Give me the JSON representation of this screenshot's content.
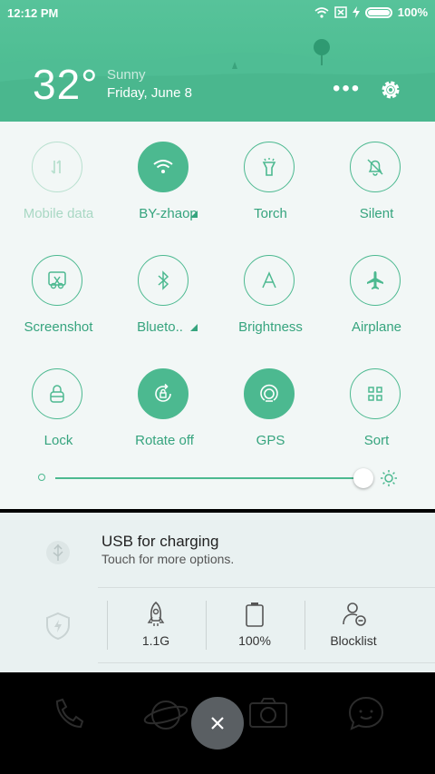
{
  "status": {
    "time": "12:12 PM",
    "battery": "100%"
  },
  "weather": {
    "temperature": "32°",
    "condition": "Sunny",
    "date": "Friday, June 8",
    "more": "•••"
  },
  "tiles": [
    {
      "label": "Mobile data",
      "icon": "mobile-data-icon",
      "state": "dim"
    },
    {
      "label": "BY-zhaop",
      "icon": "wifi-icon",
      "state": "active"
    },
    {
      "label": "Torch",
      "icon": "torch-icon",
      "state": "normal"
    },
    {
      "label": "Silent",
      "icon": "bell-off-icon",
      "state": "normal"
    },
    {
      "label": "Screenshot",
      "icon": "scissors-icon",
      "state": "normal"
    },
    {
      "label": "Blueto..",
      "icon": "bluetooth-icon",
      "state": "normal"
    },
    {
      "label": "Brightness",
      "icon": "brightness-a-icon",
      "state": "normal"
    },
    {
      "label": "Airplane",
      "icon": "airplane-icon",
      "state": "normal"
    },
    {
      "label": "Lock",
      "icon": "lock-icon",
      "state": "normal"
    },
    {
      "label": "Rotate off",
      "icon": "rotate-icon",
      "state": "active"
    },
    {
      "label": "GPS",
      "icon": "gps-icon",
      "state": "active"
    },
    {
      "label": "Sort",
      "icon": "grid-icon",
      "state": "normal"
    }
  ],
  "brightness": {
    "level": 1.0
  },
  "notification": {
    "title": "USB for charging",
    "subtitle": "Touch for more options."
  },
  "stats": [
    {
      "value": "1.1G",
      "icon": "rocket-icon"
    },
    {
      "value": "100%",
      "icon": "battery-icon"
    },
    {
      "value": "Blocklist",
      "icon": "user-block-icon"
    }
  ],
  "colors": {
    "accent": "#4cb990",
    "header": "#57c39a"
  }
}
